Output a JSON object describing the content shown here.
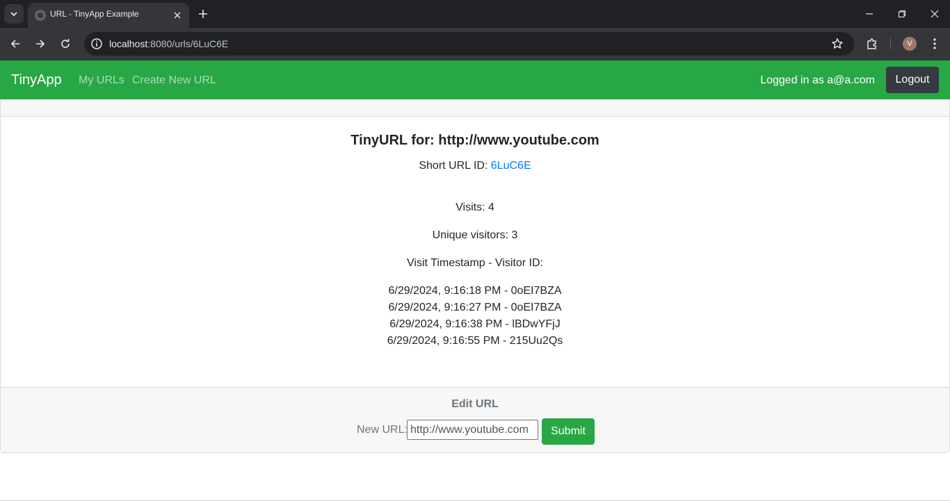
{
  "browser": {
    "tab_title": "URL - TinyApp Example",
    "url_host": "localhost",
    "url_rest": ":8080/urls/6LuC6E",
    "profile_initial": "V"
  },
  "navbar": {
    "brand": "TinyApp",
    "links": [
      "My URLs",
      "Create New URL"
    ],
    "logged_in": "Logged in as a@a.com",
    "logout": "Logout",
    "color": "#28a745"
  },
  "detail": {
    "title": "TinyURL for: http://www.youtube.com",
    "short_label": "Short URL ID: ",
    "short_id": "6LuC6E",
    "visits": "Visits: 4",
    "unique": "Unique visitors: 3",
    "table_header": "Visit Timestamp - Visitor ID:",
    "entries": [
      "6/29/2024, 9:16:18 PM - 0oEI7BZA",
      "6/29/2024, 9:16:27 PM - 0oEI7BZA",
      "6/29/2024, 9:16:38 PM - lBDwYFjJ",
      "6/29/2024, 9:16:55 PM - 215Uu2Qs"
    ]
  },
  "edit": {
    "title": "Edit URL",
    "label": "New URL:",
    "value": "http://www.youtube.com",
    "submit": "Submit"
  }
}
